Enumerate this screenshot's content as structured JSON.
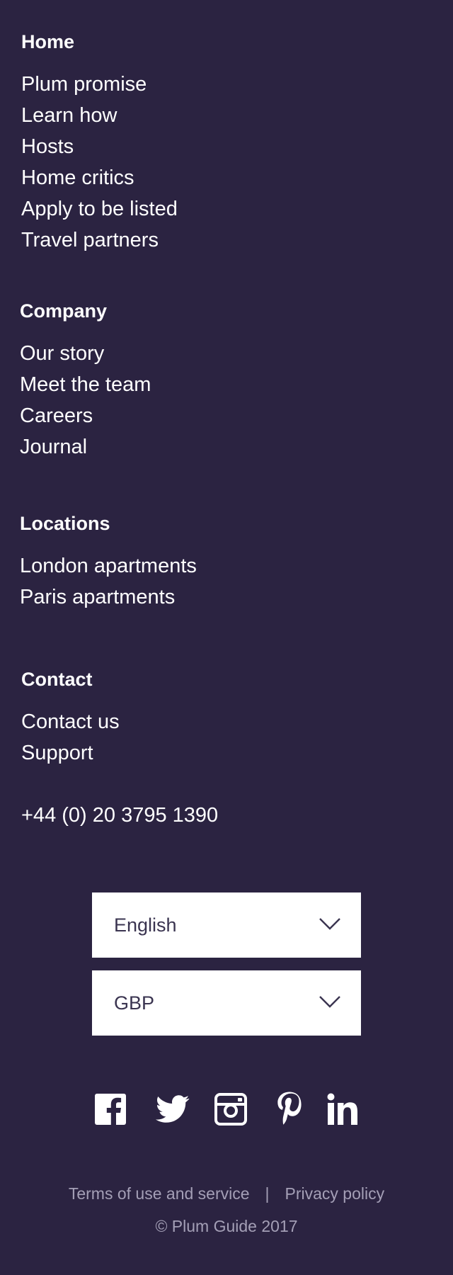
{
  "footer": {
    "home": {
      "title": "Home",
      "items": [
        "Plum promise",
        "Learn how",
        "Hosts",
        "Home critics",
        "Apply to be listed",
        "Travel partners"
      ]
    },
    "company": {
      "title": "Company",
      "items": [
        "Our story",
        "Meet the team",
        "Careers",
        "Journal"
      ]
    },
    "locations": {
      "title": "Locations",
      "items": [
        "London apartments",
        "Paris apartments"
      ]
    },
    "contact": {
      "title": "Contact",
      "items": [
        "Contact us",
        "Support"
      ],
      "phone": "+44 (0) 20 3795 1390"
    },
    "language_select": {
      "value": "English",
      "icon": "chevron-down-icon"
    },
    "currency_select": {
      "value": "GBP",
      "icon": "chevron-down-icon"
    },
    "social": [
      "facebook-icon",
      "twitter-icon",
      "instagram-icon",
      "pinterest-icon",
      "linkedin-icon"
    ],
    "legal": {
      "terms": "Terms of use and service",
      "separator": "|",
      "privacy": "Privacy policy",
      "copyright": "© Plum Guide 2017"
    },
    "colors": {
      "background": "#2b2341",
      "text": "#ffffff",
      "muted": "#a49fb6"
    }
  }
}
